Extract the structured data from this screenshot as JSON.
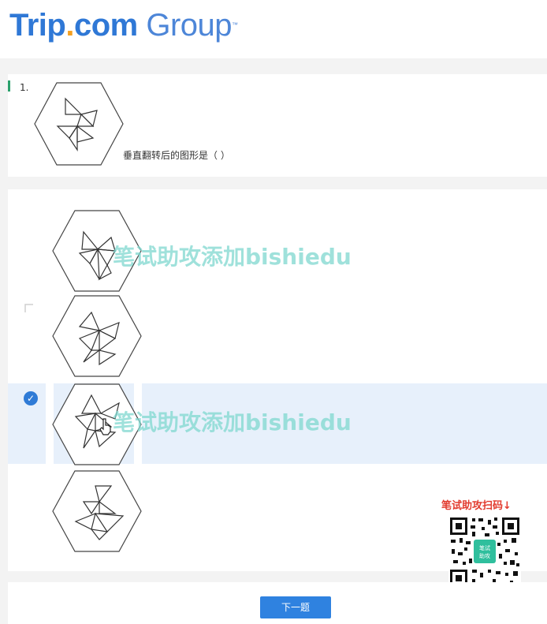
{
  "brand": {
    "name_part1": "Trip",
    "name_dot": ".",
    "name_part2": "com",
    "name_part3": "Group",
    "tm": "™",
    "primary_color": "#2f78d6",
    "accent_color": "#f4a021"
  },
  "question": {
    "number": "1.",
    "text": "垂直翻转后的图形是（ ）"
  },
  "options": [
    {
      "id": "A",
      "selected": false
    },
    {
      "id": "B",
      "selected": false
    },
    {
      "id": "C",
      "selected": true
    },
    {
      "id": "D",
      "selected": false
    }
  ],
  "watermark": "笔试助攻添加bishiedu",
  "footer": {
    "next_label": "下一题"
  },
  "promo": {
    "text": "笔试助攻扫码↓",
    "qr_center_label": "笔试助攻"
  },
  "colors": {
    "selected_bg": "#e7f0fb",
    "button_bg": "#2f82e0",
    "check": "#2f7bd6",
    "promo_text": "#e23b2e",
    "watermark": "#7fd8cf"
  }
}
